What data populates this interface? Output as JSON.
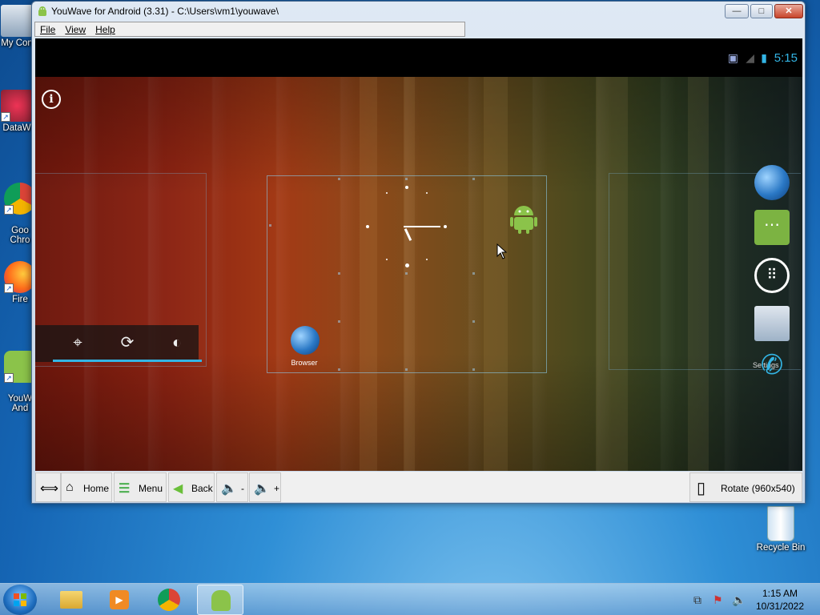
{
  "desktop": {
    "icons": [
      {
        "label": "My Con",
        "icon": "computer-icon"
      },
      {
        "label": "DataW",
        "icon": "datawarehouse-icon"
      },
      {
        "label": "Goo\nChro",
        "icon": "chrome-icon"
      },
      {
        "label": "Fire",
        "icon": "firefox-icon"
      },
      {
        "label": "YouW\nAnd",
        "icon": "youwave-icon"
      },
      {
        "label": "Recycle Bin",
        "icon": "recycle-bin-icon"
      }
    ]
  },
  "window": {
    "title": "YouWave for Android (3.31) - C:\\Users\\vm1\\youwave\\",
    "menu": [
      "File",
      "View",
      "Help"
    ],
    "min_label": "—",
    "max_label": "□",
    "close_label": "✕"
  },
  "android": {
    "status": {
      "time": "5:15"
    },
    "home": {
      "browser_label": "Browser",
      "settings_label": "Settings"
    },
    "dock_icons": [
      "browser-icon",
      "messaging-icon",
      "apps-icon",
      "contacts-icon",
      "phone-icon"
    ]
  },
  "bottombar": {
    "resize_label": "⟺",
    "home_label": "Home",
    "menu_label": "Menu",
    "back_label": "Back",
    "vol_down_label": "-",
    "vol_up_label": "+",
    "rotate_label": "Rotate (960x540)"
  },
  "taskbar": {
    "time": "1:15 AM",
    "date": "10/31/2022",
    "buttons": [
      "explorer-icon",
      "media-player-icon",
      "chrome-icon",
      "youwave-icon"
    ]
  },
  "colors": {
    "accent": "#33b5e5",
    "taskbar": "#6ea0d2"
  }
}
